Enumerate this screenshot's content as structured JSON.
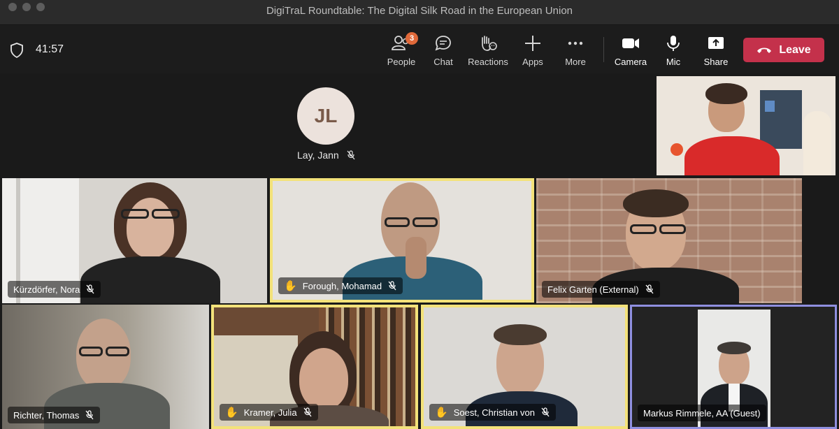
{
  "window": {
    "title": "DigiTraL Roundtable: The Digital Silk Road in the European Union"
  },
  "toolbar": {
    "timer": "41:57",
    "people": {
      "label": "People",
      "badge": "3",
      "icon": "people-icon"
    },
    "chat": {
      "label": "Chat",
      "icon": "chat-icon"
    },
    "reactions": {
      "label": "Reactions",
      "icon": "reactions-icon"
    },
    "apps": {
      "label": "Apps",
      "icon": "plus-icon"
    },
    "more": {
      "label": "More",
      "icon": "more-icon"
    },
    "camera": {
      "label": "Camera",
      "icon": "camera-icon"
    },
    "mic": {
      "label": "Mic",
      "icon": "mic-icon"
    },
    "share": {
      "label": "Share",
      "icon": "share-icon"
    },
    "leave": {
      "label": "Leave",
      "color": "#c4314b"
    }
  },
  "participants": {
    "avatar": {
      "initials": "JL",
      "name": "Lay, Jann",
      "muted": true
    },
    "self_view": {
      "name": ""
    },
    "tiles": [
      {
        "name": "Kürzdörfer, Nora",
        "muted": true,
        "hand_raised": false
      },
      {
        "name": "Forough, Mohamad",
        "muted": true,
        "hand_raised": true
      },
      {
        "name": "Felix Garten (External)",
        "muted": true,
        "hand_raised": false
      },
      {
        "name": "Richter, Thomas",
        "muted": true,
        "hand_raised": false
      },
      {
        "name": "Kramer, Julia",
        "muted": true,
        "hand_raised": true
      },
      {
        "name": "Soest, Christian von",
        "muted": true,
        "hand_raised": true
      },
      {
        "name": "Markus Rimmele, AA (Guest)",
        "muted": false,
        "hand_raised": false
      }
    ]
  },
  "colors": {
    "speaking_highlight": "#f3e27a",
    "pinned_highlight": "#8f8fe0",
    "badge": "#e0693a"
  }
}
